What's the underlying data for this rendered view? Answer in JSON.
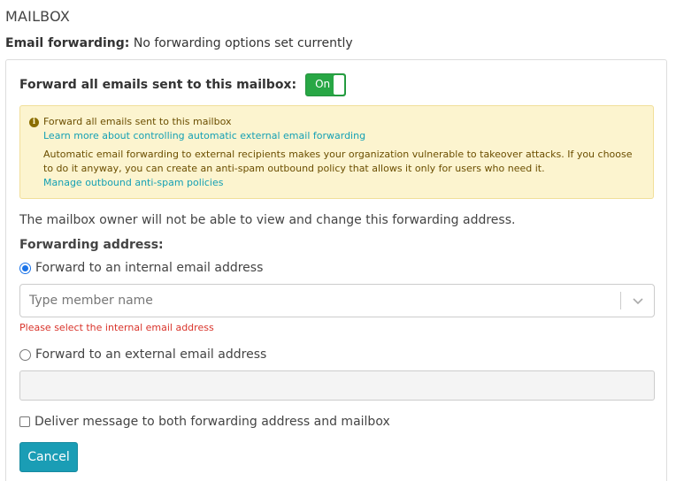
{
  "page": {
    "title": "MAILBOX"
  },
  "email_forwarding": {
    "label": "Email forwarding:",
    "status": "No forwarding options set currently"
  },
  "forward_all": {
    "label": "Forward all emails sent to this mailbox:",
    "toggle_text": "On",
    "toggle_on": true,
    "toggle_color": "#28a745"
  },
  "warning": {
    "icon": "info-icon",
    "title": "Forward all emails sent to this mailbox",
    "link_learn": "Learn more about controlling automatic external email forwarding",
    "body": "Automatic email forwarding to external recipients makes your organization vulnerable to takeover attacks. If you choose to do it anyway, you can create an anti-spam outbound policy that allows it only for users who need it.",
    "link_manage": "Manage outbound anti-spam policies",
    "background": "#fcf4cf",
    "link_color": "#14a0b4"
  },
  "owner_note": "The mailbox owner will not be able to view and change this forwarding address.",
  "forwarding_address": {
    "label": "Forwarding address:",
    "internal": {
      "label": "Forward to an internal email address",
      "checked": true,
      "placeholder": "Type member name",
      "error": "Please select the internal email address"
    },
    "external": {
      "label": "Forward to an external email address",
      "checked": false,
      "value": ""
    }
  },
  "deliver_both": {
    "label": "Deliver message to both forwarding address and mailbox",
    "checked": false
  },
  "actions": {
    "cancel_label": "Cancel",
    "cancel_color": "#1a9db5"
  },
  "colors": {
    "error": "#d9342b",
    "radio_selected": "#1a73e8"
  }
}
